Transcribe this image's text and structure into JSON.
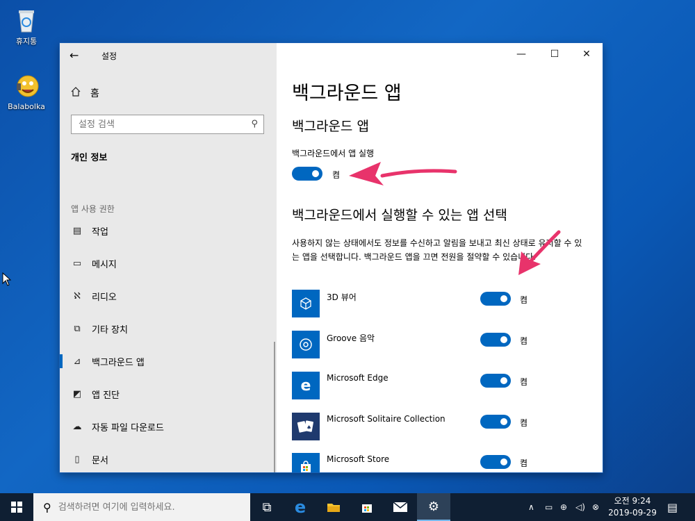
{
  "desktop": {
    "icons": [
      {
        "label": "휴지통",
        "icon": "recycle-bin-icon"
      },
      {
        "label": "Balabolka",
        "icon": "balabolka-icon"
      }
    ]
  },
  "window": {
    "title": "설정",
    "controls": {
      "minimize": "—",
      "maximize": "☐",
      "close": "✕"
    }
  },
  "sidebar": {
    "home_label": "홈",
    "search_placeholder": "설정 검색",
    "section_title": "개인 정보",
    "group_label": "앱 사용 권한",
    "items": [
      {
        "label": "작업",
        "icon": "task-icon"
      },
      {
        "label": "메시지",
        "icon": "message-icon"
      },
      {
        "label": "리디오",
        "icon": "radio-icon"
      },
      {
        "label": "기타 장치",
        "icon": "devices-icon"
      },
      {
        "label": "백그라운드 앱",
        "icon": "background-apps-icon",
        "selected": true
      },
      {
        "label": "앱 진단",
        "icon": "diagnostics-icon"
      },
      {
        "label": "자동 파일 다운로드",
        "icon": "cloud-icon"
      },
      {
        "label": "문서",
        "icon": "document-icon"
      }
    ]
  },
  "main": {
    "page_title": "백그라운드 앱",
    "section1_title": "백그라운드 앱",
    "run_label": "백그라운드에서 앱 실행",
    "run_state": "켬",
    "section2_title": "백그라운드에서 실행할 수 있는 앱 선택",
    "description": "사용하지 않는 상태에서도 정보를 수신하고 알림을 보내고 최신 상태로 유지할 수 있는 앱을 선택합니다. 백그라운드 앱을 끄면 전원을 절약할 수 있습니다.",
    "apps": [
      {
        "name": "3D 뷰어",
        "state": "켬",
        "icon": "cube-icon"
      },
      {
        "name": "Groove 음악",
        "state": "켬",
        "icon": "music-disc-icon"
      },
      {
        "name": "Microsoft Edge",
        "state": "켬",
        "icon": "edge-icon"
      },
      {
        "name": "Microsoft Solitaire Collection",
        "state": "켬",
        "icon": "cards-icon"
      },
      {
        "name": "Microsoft Store",
        "state": "켬",
        "icon": "store-icon"
      }
    ]
  },
  "taskbar": {
    "search_placeholder": "검색하려면 여기에 입력하세요.",
    "time": "오전 9:24",
    "date": "2019-09-29"
  },
  "colors": {
    "accent": "#0067c0",
    "arrow": "#e8336b",
    "taskbar": "#0f1f33"
  }
}
